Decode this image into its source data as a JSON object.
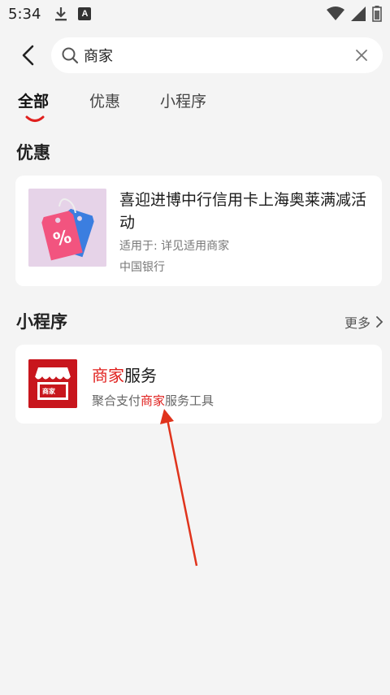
{
  "status": {
    "time": "5:34",
    "a_badge": "A"
  },
  "search": {
    "query": "商家"
  },
  "tabs": [
    {
      "label": "全部"
    },
    {
      "label": "优惠"
    },
    {
      "label": "小程序"
    }
  ],
  "discount_section": {
    "title": "优惠",
    "card": {
      "title": "喜迎进博中行信用卡上海奥莱满减活动",
      "applies": "适用于: 详见适用商家",
      "bank": "中国银行"
    }
  },
  "mini_section": {
    "title": "小程序",
    "more": "更多",
    "card": {
      "name_highlight": "商家",
      "name_rest": "服务",
      "desc_prefix": "聚合支付",
      "desc_highlight": "商家",
      "desc_suffix": "服务工具",
      "icon_label": "商家"
    }
  },
  "colors": {
    "accent": "#e0201e",
    "app_icon_bg": "#c8161d",
    "arrow": "#e0331c"
  }
}
